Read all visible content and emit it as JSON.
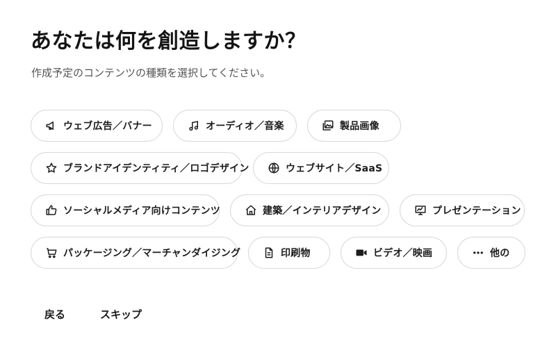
{
  "header": {
    "title": "あなたは何を創造しますか？",
    "subtitle": "作成予定のコンテンツの種類を選択してください。"
  },
  "options": [
    {
      "label": "ウェブ広告／バナー",
      "icon": "megaphone-icon"
    },
    {
      "label": "オーディオ／音楽",
      "icon": "music-note-icon"
    },
    {
      "label": "製品画像",
      "icon": "image-icon"
    },
    {
      "label": "ブランドアイデンティティ／ロゴデザイン",
      "icon": "star-icon"
    },
    {
      "label": "ウェブサイト／SaaS",
      "icon": "globe-icon"
    },
    {
      "label": "ソーシャルメディア向けコンテンツ",
      "icon": "thumbs-up-icon"
    },
    {
      "label": "建築／インテリアデザイン",
      "icon": "house-icon"
    },
    {
      "label": "プレゼンテーション",
      "icon": "presentation-icon"
    },
    {
      "label": "パッケージング／マーチャンダイジング",
      "icon": "cart-icon"
    },
    {
      "label": "印刷物",
      "icon": "document-icon"
    },
    {
      "label": "ビデオ／映画",
      "icon": "video-camera-icon"
    },
    {
      "label": "他の",
      "icon": "more-dots-icon"
    }
  ],
  "footer": {
    "back_label": "戻る",
    "skip_label": "スキップ"
  }
}
